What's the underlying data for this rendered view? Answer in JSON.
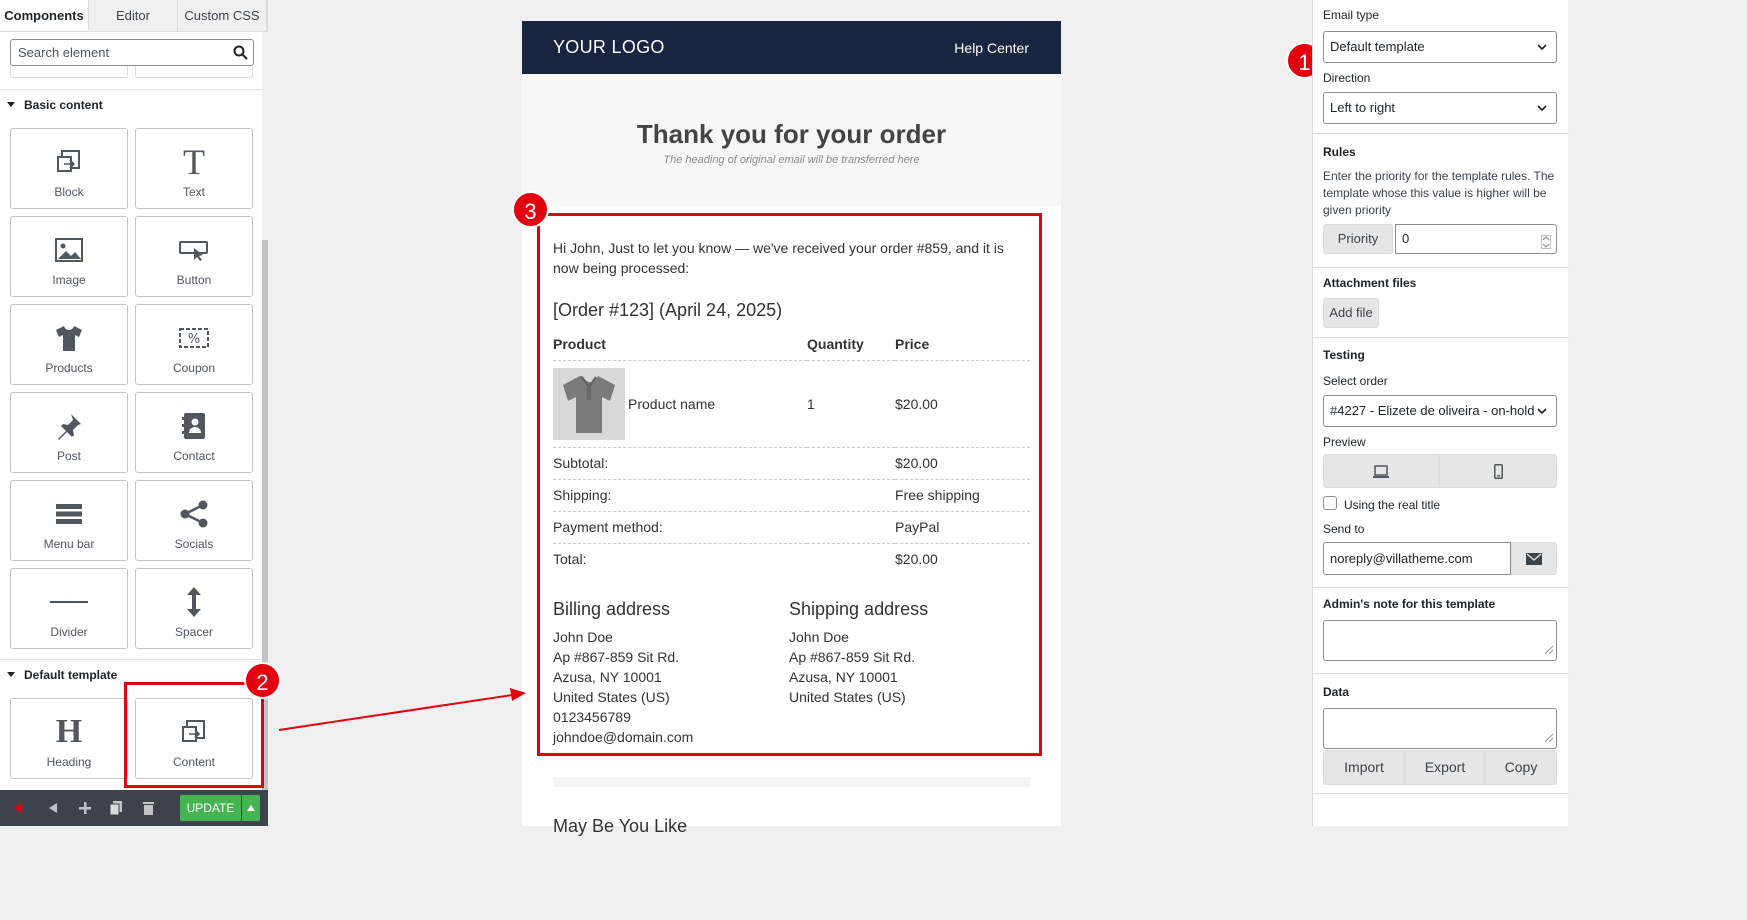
{
  "left_panel": {
    "tabs": [
      "Components",
      "Editor",
      "Custom CSS"
    ],
    "search_placeholder": "Search element",
    "basic_section": "Basic content",
    "basic_items": [
      {
        "label": "Block",
        "icon": "block-icon"
      },
      {
        "label": "Text",
        "icon": "text-icon"
      },
      {
        "label": "Image",
        "icon": "image-icon"
      },
      {
        "label": "Button",
        "icon": "button-icon"
      },
      {
        "label": "Products",
        "icon": "tshirt-icon"
      },
      {
        "label": "Coupon",
        "icon": "coupon-icon"
      },
      {
        "label": "Post",
        "icon": "pin-icon"
      },
      {
        "label": "Contact",
        "icon": "contact-icon"
      },
      {
        "label": "Menu bar",
        "icon": "menu-icon"
      },
      {
        "label": "Socials",
        "icon": "share-icon"
      },
      {
        "label": "Divider",
        "icon": "divider-icon"
      },
      {
        "label": "Spacer",
        "icon": "spacer-icon"
      }
    ],
    "default_section": "Default template",
    "default_items": [
      {
        "label": "Heading",
        "icon": "heading-icon"
      },
      {
        "label": "Content",
        "icon": "content-icon"
      }
    ],
    "update_label": "UPDATE"
  },
  "email": {
    "logo": "YOUR LOGO",
    "help": "Help Center",
    "title": "Thank you for your order",
    "subtitle": "The heading of original email will be transferred here",
    "intro": "Hi John, Just to let you know — we've received your order #859, and it is now being processed:",
    "order_heading": "[Order #123] (April 24, 2025)",
    "table_headers": [
      "Product",
      "Quantity",
      "Price"
    ],
    "product": {
      "name": "Product name",
      "qty": "1",
      "price": "$20.00"
    },
    "totals": [
      {
        "label": "Subtotal:",
        "value": "$20.00"
      },
      {
        "label": "Shipping:",
        "value": "Free shipping"
      },
      {
        "label": "Payment method:",
        "value": "PayPal"
      },
      {
        "label": "Total:",
        "value": "$20.00"
      }
    ],
    "billing": {
      "title": "Billing address",
      "lines": [
        "John Doe",
        "Ap #867-859 Sit Rd.",
        "Azusa, NY 10001",
        "United States (US)",
        "0123456789",
        "johndoe@domain.com"
      ]
    },
    "shipping": {
      "title": "Shipping address",
      "lines": [
        "John Doe",
        "Ap #867-859 Sit Rd.",
        "Azusa, NY 10001",
        "United States (US)"
      ]
    },
    "maybe_like": "May Be You Like"
  },
  "annotations": [
    "1",
    "2",
    "3"
  ],
  "right_panel": {
    "email_type_label": "Email type",
    "email_type_value": "Default template",
    "direction_label": "Direction",
    "direction_value": "Left to right",
    "rules_label": "Rules",
    "rules_text": "Enter the priority for the template rules. The template whose this value is higher will be given priority",
    "priority_label": "Priority",
    "priority_value": "0",
    "attach_label": "Attachment files",
    "add_file": "Add file",
    "testing_label": "Testing",
    "select_order_label": "Select order",
    "select_order_value": "#4227 - Elizete de oliveira - on-hold",
    "preview_label": "Preview",
    "real_title_label": "Using the real title",
    "send_to_label": "Send to",
    "send_to_value": "noreply@villatheme.com",
    "admin_note_label": "Admin's note for this template",
    "data_label": "Data",
    "import": "Import",
    "export": "Export",
    "copy": "Copy"
  },
  "colors": {
    "accent_red": "#e3000f",
    "email_header": "#192440",
    "update_green": "#46b450"
  }
}
